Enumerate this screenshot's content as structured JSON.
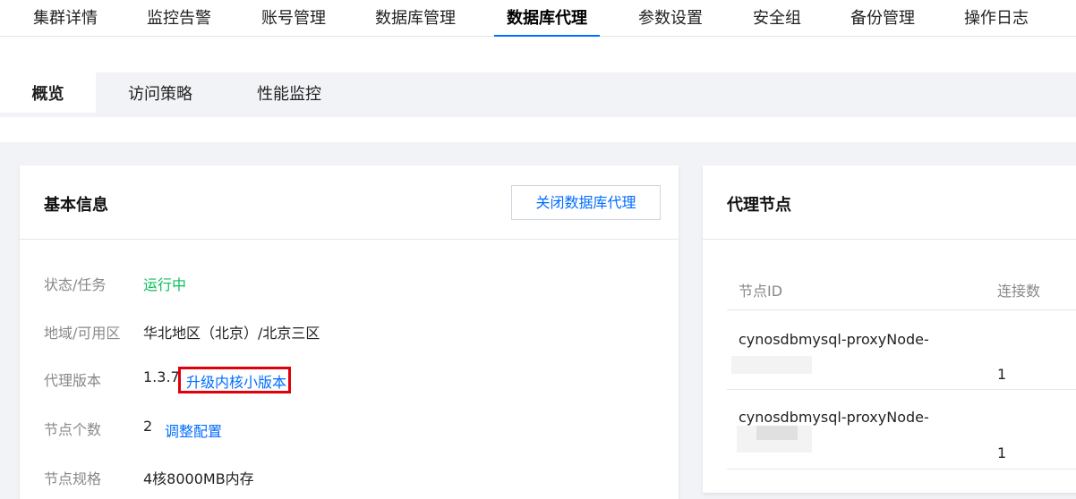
{
  "top_tabs": [
    {
      "label": "集群详情"
    },
    {
      "label": "监控告警"
    },
    {
      "label": "账号管理"
    },
    {
      "label": "数据库管理"
    },
    {
      "label": "数据库代理",
      "active": true
    },
    {
      "label": "参数设置"
    },
    {
      "label": "安全组"
    },
    {
      "label": "备份管理"
    },
    {
      "label": "操作日志"
    }
  ],
  "sub_tabs": [
    {
      "label": "概览",
      "active": true
    },
    {
      "label": "访问策略"
    },
    {
      "label": "性能监控"
    }
  ],
  "basic_info": {
    "title": "基本信息",
    "close_proxy_button": "关闭数据库代理",
    "rows": [
      {
        "label": "状态/任务",
        "value": "运行中"
      },
      {
        "label": "地域/可用区",
        "value": "华北地区（北京）/北京三区"
      },
      {
        "label": "代理版本",
        "value": "1.3.7",
        "link": "升级内核小版本"
      },
      {
        "label": "节点个数",
        "value": "2",
        "link": "调整配置"
      },
      {
        "label": "节点规格",
        "value": "4核8000MB内存"
      }
    ]
  },
  "proxy_nodes": {
    "title": "代理节点",
    "columns": [
      "节点ID",
      "连接数"
    ],
    "rows": [
      {
        "node_id": "cynosdbmysql-proxyNode-",
        "connections": "1"
      },
      {
        "node_id": "cynosdbmysql-proxyNode-",
        "connections": "1"
      }
    ]
  },
  "colors": {
    "accent": "#006eff",
    "running": "#0abf5b",
    "highlight": "#e1000a"
  }
}
